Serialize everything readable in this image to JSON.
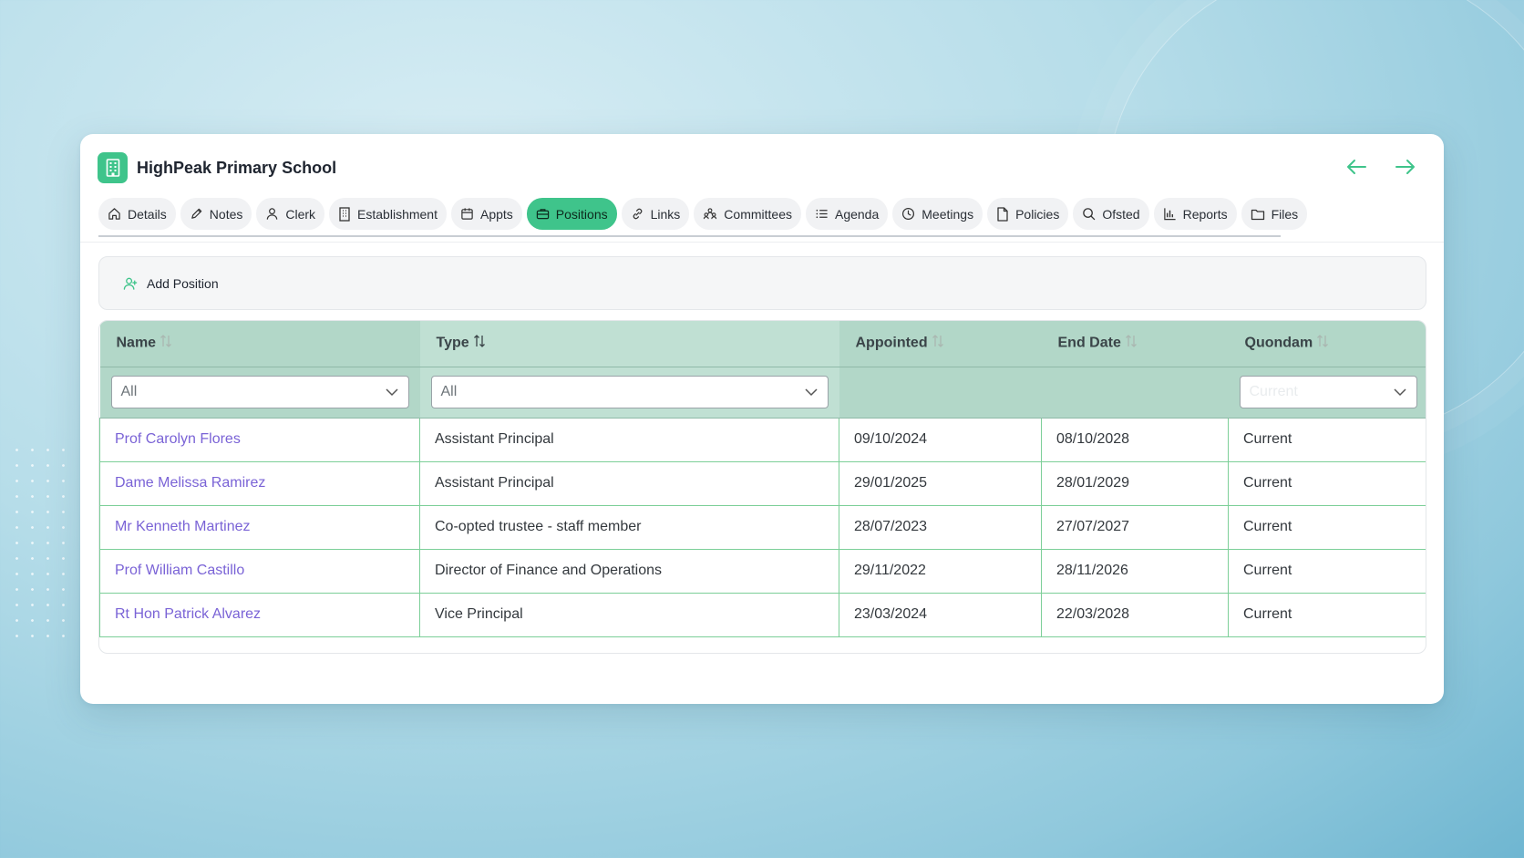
{
  "app": {
    "title": "HighPeak Primary School",
    "icon": "building-icon",
    "accent": "#3fc48b"
  },
  "nav": {
    "back_icon": "arrow-left-icon",
    "forward_icon": "arrow-right-icon"
  },
  "tabs": [
    {
      "label": "Details",
      "icon": "home-icon",
      "active": false
    },
    {
      "label": "Notes",
      "icon": "pencil-icon",
      "active": false
    },
    {
      "label": "Clerk",
      "icon": "user-icon",
      "active": false
    },
    {
      "label": "Establishment",
      "icon": "building-icon",
      "active": false
    },
    {
      "label": "Appts",
      "icon": "calendar-icon",
      "active": false
    },
    {
      "label": "Positions",
      "icon": "briefcase-icon",
      "active": true
    },
    {
      "label": "Links",
      "icon": "link-icon",
      "active": false
    },
    {
      "label": "Committees",
      "icon": "people-icon",
      "active": false
    },
    {
      "label": "Agenda",
      "icon": "list-icon",
      "active": false
    },
    {
      "label": "Meetings",
      "icon": "clock-icon",
      "active": false
    },
    {
      "label": "Policies",
      "icon": "document-icon",
      "active": false
    },
    {
      "label": "Ofsted",
      "icon": "search-icon",
      "active": false
    },
    {
      "label": "Reports",
      "icon": "bar-chart-icon",
      "active": false
    },
    {
      "label": "Files",
      "icon": "folder-icon",
      "active": false
    }
  ],
  "toolbar": {
    "add_label": "Add Position",
    "add_icon": "user-plus-icon"
  },
  "table": {
    "columns": [
      "Name",
      "Type",
      "Appointed",
      "End Date",
      "Quondam"
    ],
    "filters": {
      "name": "All",
      "type": "All",
      "quondam": "Current"
    },
    "rows": [
      {
        "name": "Prof Carolyn Flores",
        "type": "Assistant Principal",
        "appointed": "09/10/2024",
        "end_date": "08/10/2028",
        "quondam": "Current"
      },
      {
        "name": "Dame Melissa Ramirez",
        "type": "Assistant Principal",
        "appointed": "29/01/2025",
        "end_date": "28/01/2029",
        "quondam": "Current"
      },
      {
        "name": "Mr Kenneth Martinez",
        "type": "Co-opted trustee - staff member",
        "appointed": "28/07/2023",
        "end_date": "27/07/2027",
        "quondam": "Current"
      },
      {
        "name": "Prof William Castillo",
        "type": "Director of Finance and Operations",
        "appointed": "29/11/2022",
        "end_date": "28/11/2026",
        "quondam": "Current"
      },
      {
        "name": "Rt Hon Patrick Alvarez",
        "type": "Vice Principal",
        "appointed": "23/03/2024",
        "end_date": "22/03/2028",
        "quondam": "Current"
      }
    ]
  }
}
